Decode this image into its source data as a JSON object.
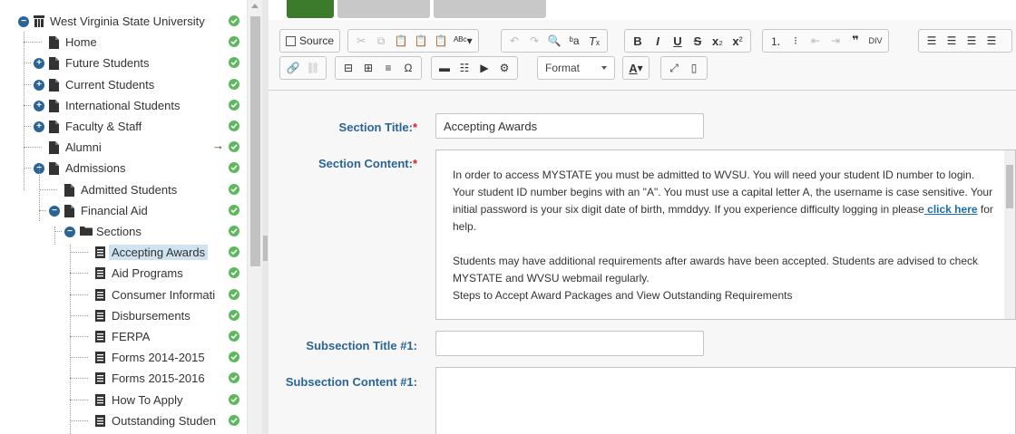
{
  "tree": {
    "items": [
      {
        "label": "West Virginia State University",
        "toggle": "−",
        "icon": "site-icon"
      },
      {
        "label": "Home",
        "toggle": "",
        "icon": "page-icon"
      },
      {
        "label": "Future Students",
        "toggle": "+",
        "icon": "page-icon"
      },
      {
        "label": "Current Students",
        "toggle": "+",
        "icon": "page-icon"
      },
      {
        "label": "International Students",
        "toggle": "+",
        "icon": "page-icon"
      },
      {
        "label": "Faculty & Staff",
        "toggle": "+",
        "icon": "page-icon"
      },
      {
        "label": "Alumni",
        "toggle": "",
        "icon": "page-icon",
        "arrow": "→"
      },
      {
        "label": "Admissions",
        "toggle": "−",
        "icon": "page-icon"
      },
      {
        "label": "Admitted Students",
        "toggle": "",
        "icon": "page-icon"
      },
      {
        "label": "Financial Aid",
        "toggle": "−",
        "icon": "page-icon"
      },
      {
        "label": "Sections",
        "toggle": "−",
        "icon": "folder-icon"
      },
      {
        "label": "Accepting Awards",
        "toggle": "",
        "icon": "section-icon",
        "selected": true
      },
      {
        "label": "Aid Programs",
        "toggle": "",
        "icon": "section-icon"
      },
      {
        "label": "Consumer Informati",
        "toggle": "",
        "icon": "section-icon"
      },
      {
        "label": "Disbursements",
        "toggle": "",
        "icon": "section-icon"
      },
      {
        "label": "FERPA",
        "toggle": "",
        "icon": "section-icon"
      },
      {
        "label": "Forms 2014-2015",
        "toggle": "",
        "icon": "section-icon"
      },
      {
        "label": "Forms 2015-2016",
        "toggle": "",
        "icon": "section-icon"
      },
      {
        "label": "How To Apply",
        "toggle": "",
        "icon": "section-icon"
      },
      {
        "label": "Outstanding Studen",
        "toggle": "",
        "icon": "section-icon"
      }
    ]
  },
  "toolbar": {
    "source_label": "Source",
    "format_label": "Format",
    "text_color_label": "A"
  },
  "form": {
    "section_title_label": "Section Title:",
    "section_title_value": "Accepting Awards",
    "section_content_label": "Section Content:",
    "required_mark": "*",
    "content": {
      "p1": "In order to access MYSTATE you must be admitted to WVSU. You will need your student ID number to login. Your student ID number begins with an \"A\". You must use a capital letter A, the username is case sensitive. Your initial password is your six digit date of birth, mmddyy. If you experience difficulty logging in please",
      "link": " click here",
      "p1_end": " for help.",
      "p2": "Students may have additional requirements after awards have been accepted. Students are advised to check MYSTATE and WVSU webmail regularly.",
      "p3": "Steps to Accept Award Packages and View Outstanding Requirements"
    },
    "subsection_title_label": "Subsection Title #1:",
    "subsection_title_value": "",
    "subsection_content_label": "Subsection Content #1:"
  },
  "colors": {
    "accent": "#2a6496",
    "status_ok": "#5cb85c",
    "required": "#e0201a",
    "selected_bg": "#cfe2ef",
    "link": "#1a6fb5"
  }
}
